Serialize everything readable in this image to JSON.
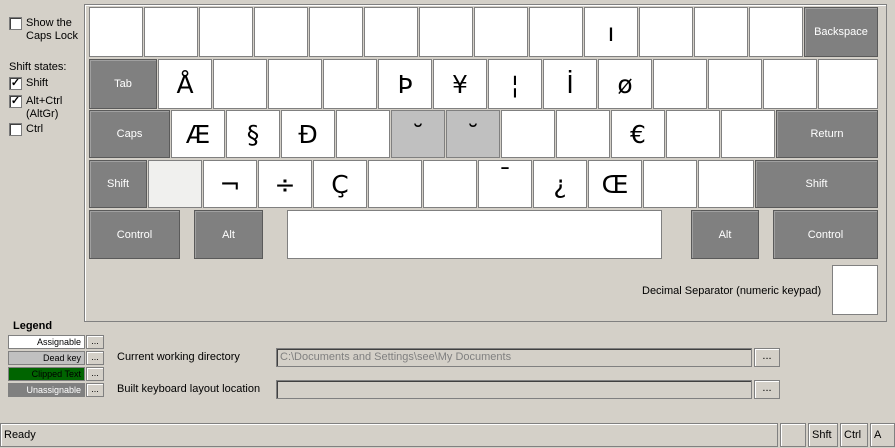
{
  "left_panel": {
    "show_caps_lock": {
      "label_line1": "Show the",
      "label_line2": "Caps Lock",
      "checked": false
    },
    "shift_states_title": "Shift states:",
    "shift": {
      "label": "Shift",
      "checked": true
    },
    "altgr": {
      "label_line1": "Alt+Ctrl",
      "label_line2": "(AltGr)",
      "checked": true
    },
    "ctrl": {
      "label": "Ctrl",
      "checked": false
    }
  },
  "keyboard": {
    "row1": [
      "",
      "",
      "",
      "",
      "",
      "",
      "",
      "",
      "",
      "ı",
      "",
      ""
    ],
    "backspace": "Backspace",
    "tab": "Tab",
    "row2": [
      "Å",
      "",
      "",
      "",
      "Þ",
      "¥",
      "¦",
      "İ",
      "ø",
      "",
      "",
      ""
    ],
    "caps": "Caps",
    "row3": [
      "Æ",
      "§",
      "Đ",
      "",
      "˘",
      "˘",
      "",
      "",
      "€",
      "",
      ""
    ],
    "return": "Return",
    "shift_left": "Shift",
    "row4": [
      "",
      "¬",
      "÷",
      "Ç",
      "",
      "",
      "¯",
      "¿",
      "Œ",
      "",
      ""
    ],
    "shift_right": "Shift",
    "control_left": "Control",
    "alt_left": "Alt",
    "alt_right": "Alt",
    "control_right": "Control",
    "decimal_separator_label": "Decimal Separator (numeric keypad)",
    "decimal_separator_value": ""
  },
  "legend": {
    "title": "Legend",
    "items": [
      {
        "label": "Assignable",
        "bg": "#ffffff",
        "fg": "#000000"
      },
      {
        "label": "Dead key",
        "bg": "#c0c0c0",
        "fg": "#000000"
      },
      {
        "label": "Clipped Text",
        "bg": "#006400",
        "fg": "#000000"
      },
      {
        "label": "Unassignable",
        "bg": "#808080",
        "fg": "#ffffff"
      }
    ],
    "button_label": "..."
  },
  "paths": {
    "cwd_label": "Current working directory",
    "cwd_value": "C:\\Documents and Settings\\see\\My Documents",
    "build_label": "Built keyboard layout location",
    "build_value": "",
    "browse_label": "..."
  },
  "statusbar": {
    "status": "Ready",
    "shift": "Shft",
    "ctrl": "Ctrl",
    "alt": "A"
  }
}
